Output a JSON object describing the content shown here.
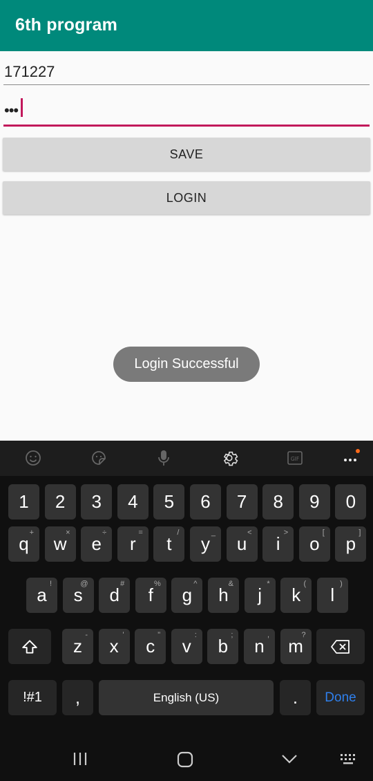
{
  "app": {
    "title": "6th program"
  },
  "form": {
    "username_value": "171227",
    "password_mask": "•••",
    "save_label": "SAVE",
    "login_label": "LOGIN"
  },
  "toast": {
    "message": "Login Successful"
  },
  "keyboard": {
    "numbers": [
      "1",
      "2",
      "3",
      "4",
      "5",
      "6",
      "7",
      "8",
      "9",
      "0"
    ],
    "row1": [
      {
        "k": "q",
        "h": "+"
      },
      {
        "k": "w",
        "h": "×"
      },
      {
        "k": "e",
        "h": "÷"
      },
      {
        "k": "r",
        "h": "="
      },
      {
        "k": "t",
        "h": "/"
      },
      {
        "k": "y",
        "h": "_"
      },
      {
        "k": "u",
        "h": "<"
      },
      {
        "k": "i",
        "h": ">"
      },
      {
        "k": "o",
        "h": "["
      },
      {
        "k": "p",
        "h": "]"
      }
    ],
    "row2": [
      {
        "k": "a",
        "h": "!"
      },
      {
        "k": "s",
        "h": "@"
      },
      {
        "k": "d",
        "h": "#"
      },
      {
        "k": "f",
        "h": "%"
      },
      {
        "k": "g",
        "h": "^"
      },
      {
        "k": "h",
        "h": "&"
      },
      {
        "k": "j",
        "h": "*"
      },
      {
        "k": "k",
        "h": "("
      },
      {
        "k": "l",
        "h": ")"
      }
    ],
    "row3": [
      {
        "k": "z",
        "h": "-"
      },
      {
        "k": "x",
        "h": "'"
      },
      {
        "k": "c",
        "h": "\""
      },
      {
        "k": "v",
        "h": ":"
      },
      {
        "k": "b",
        "h": ";"
      },
      {
        "k": "n",
        "h": ","
      },
      {
        "k": "m",
        "h": "?"
      }
    ],
    "symbols_label": "!#1",
    "comma_label": ",",
    "space_label": "English (US)",
    "period_label": ".",
    "done_label": "Done",
    "accent_color": "#2f80ed"
  },
  "colors": {
    "appbar": "#00897b",
    "focus_underline": "#c2185b"
  }
}
